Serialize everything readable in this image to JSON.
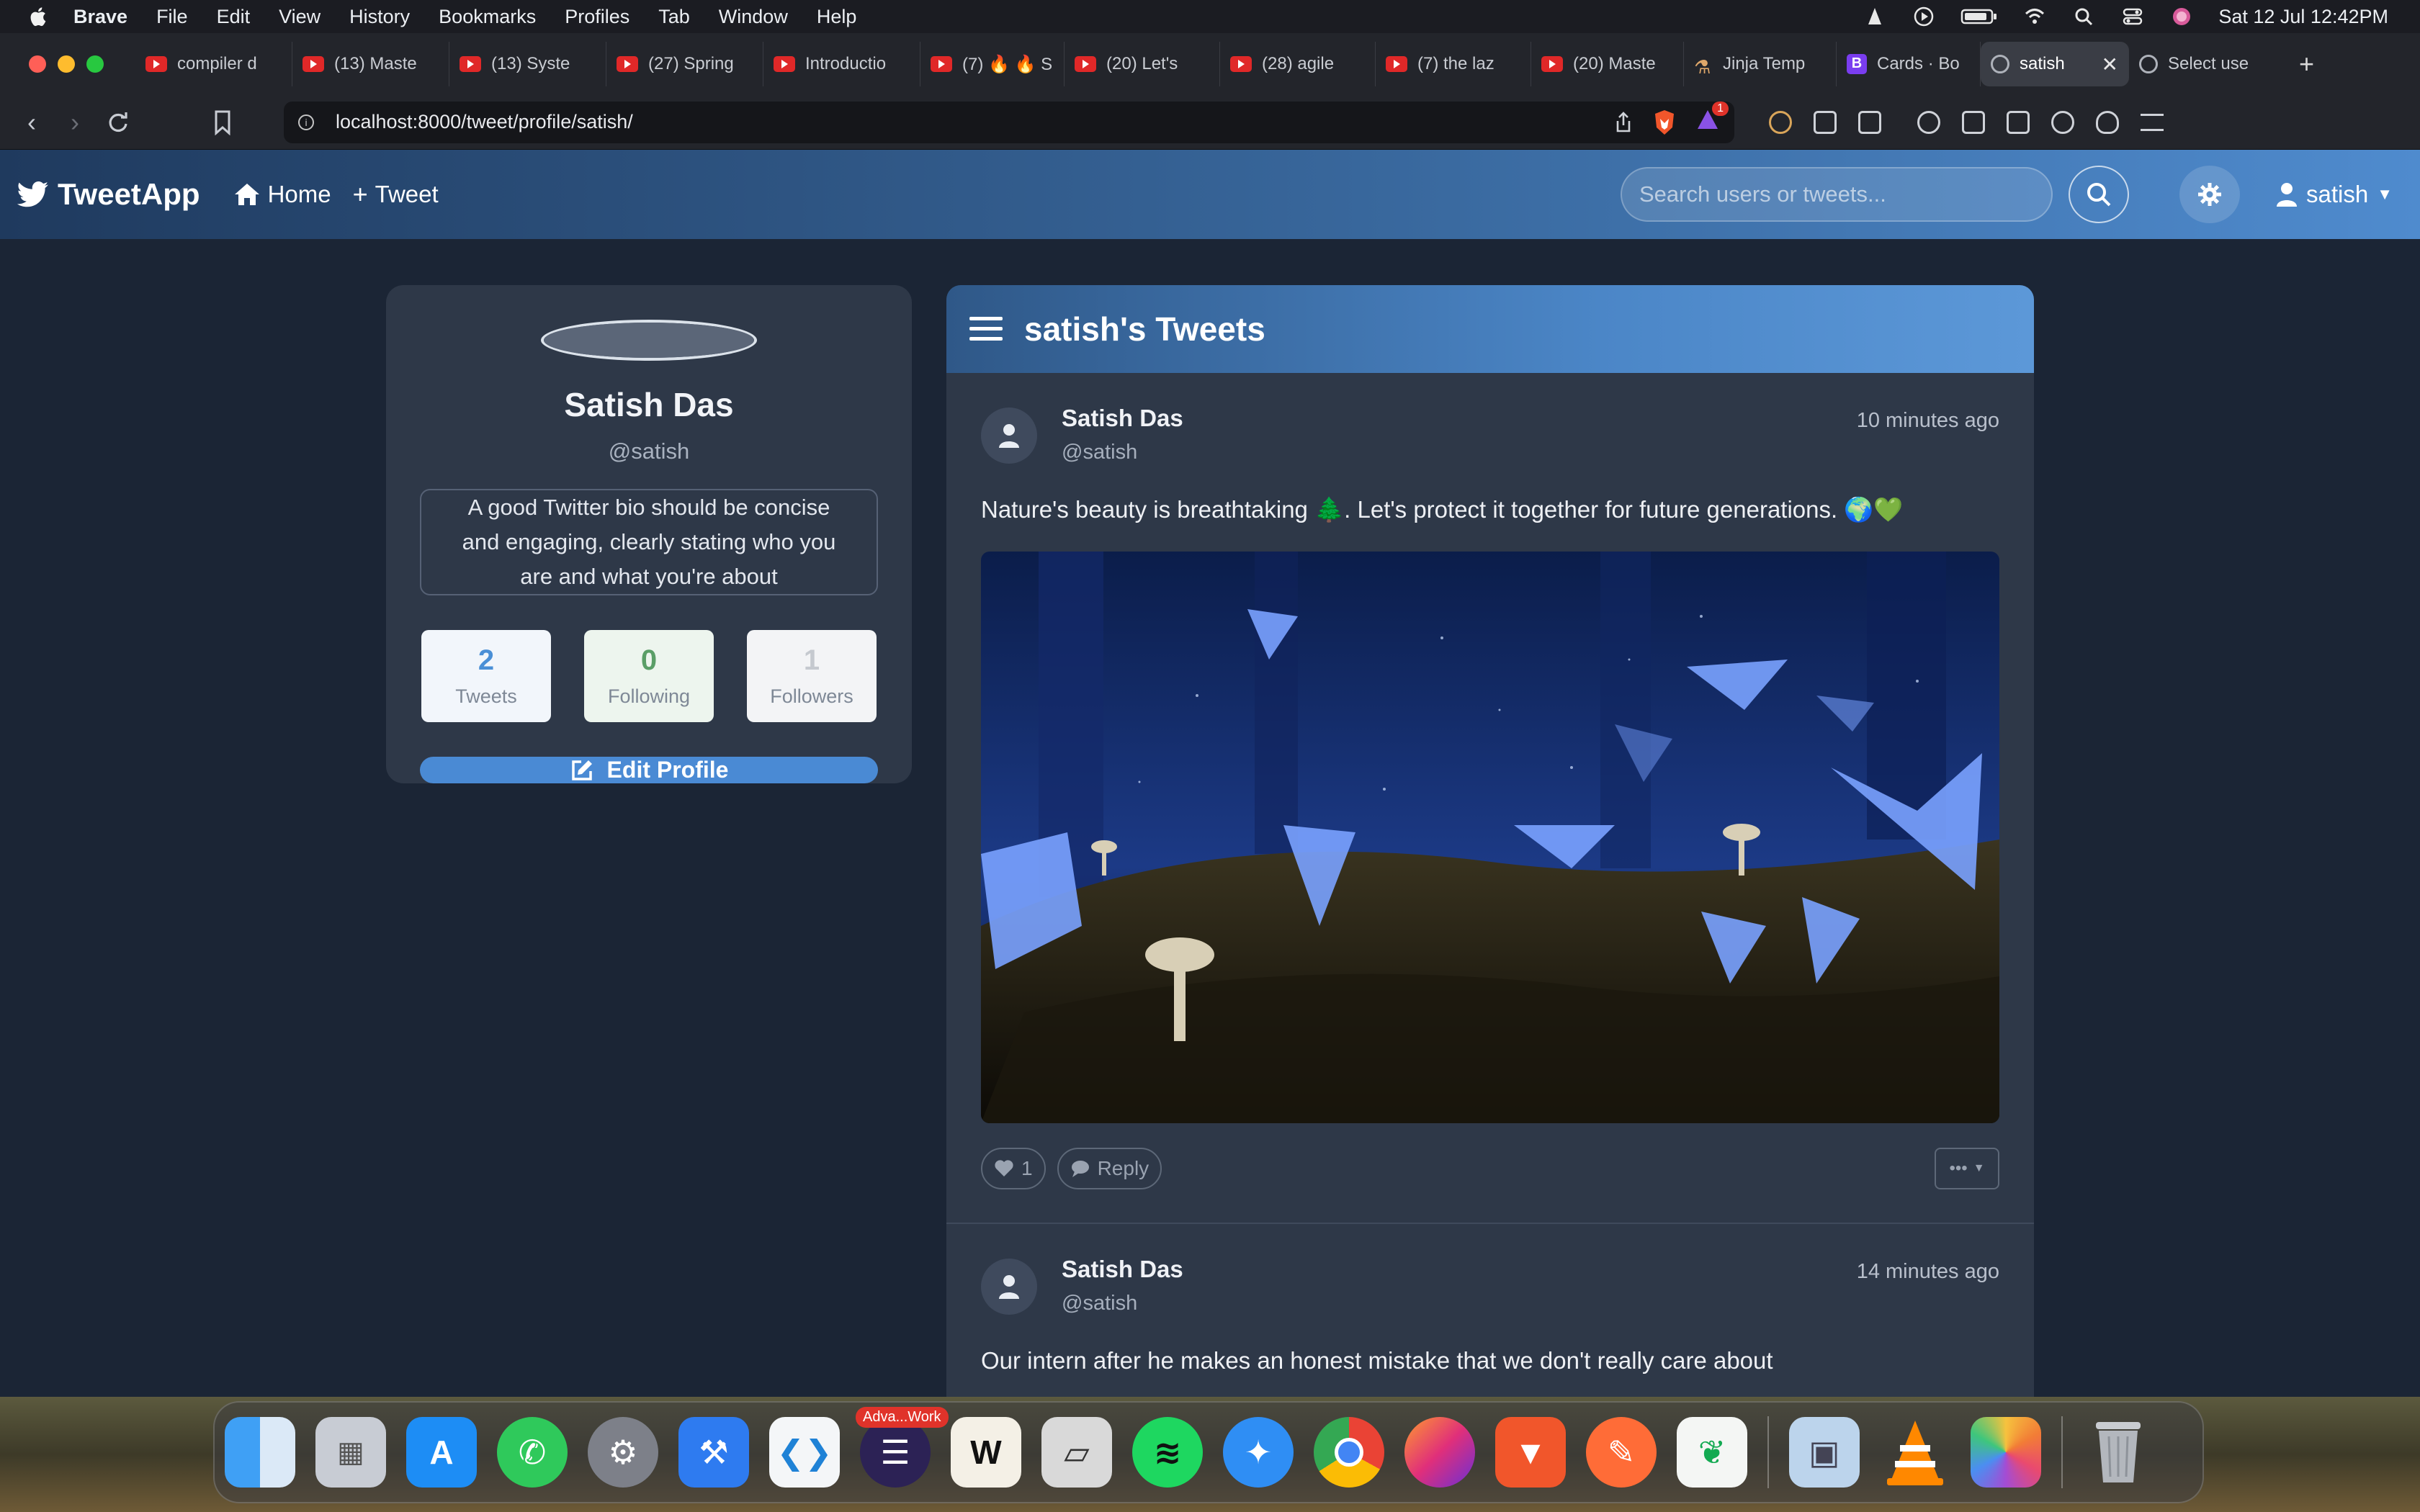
{
  "menubar": {
    "app_name": "Brave",
    "items": [
      "File",
      "Edit",
      "View",
      "History",
      "Bookmarks",
      "Profiles",
      "Tab",
      "Window",
      "Help"
    ],
    "datetime": "Sat 12 Jul  12:42PM"
  },
  "tabs": [
    {
      "label": "compiler d",
      "icon": "youtube-icon"
    },
    {
      "label": "(13) Maste",
      "icon": "youtube-icon"
    },
    {
      "label": "(13) Syste",
      "icon": "youtube-icon"
    },
    {
      "label": "(27) Spring",
      "icon": "youtube-icon"
    },
    {
      "label": "Introductio",
      "icon": "youtube-icon"
    },
    {
      "label": "(7) 🔥 🔥 S",
      "icon": "youtube-icon"
    },
    {
      "label": "(20) Let's",
      "icon": "youtube-icon"
    },
    {
      "label": "(28) agile",
      "icon": "youtube-icon"
    },
    {
      "label": "(7) the laz",
      "icon": "youtube-icon"
    },
    {
      "label": "(20) Maste",
      "icon": "youtube-icon"
    },
    {
      "label": "Jinja Temp",
      "icon": "flask-icon"
    },
    {
      "label": "Cards · Bo",
      "icon": "bootstrap-icon"
    },
    {
      "label": "satish",
      "icon": "globe-icon",
      "active": true
    },
    {
      "label": "Select use",
      "icon": "globe-icon"
    }
  ],
  "address_bar": {
    "url": "localhost:8000/tweet/profile/satish/",
    "shield_badge": "1"
  },
  "app": {
    "brand": "TweetApp",
    "nav_home": "Home",
    "nav_tweet": "Tweet",
    "search_placeholder": "Search users or tweets...",
    "username": "satish"
  },
  "profile": {
    "name": "Satish Das",
    "handle": "@satish",
    "bio": "A good Twitter bio should be concise and engaging, clearly stating who you are and what you're about",
    "stats": {
      "tweets": {
        "value": "2",
        "label": "Tweets"
      },
      "following": {
        "value": "0",
        "label": "Following"
      },
      "followers": {
        "value": "1",
        "label": "Followers"
      }
    },
    "edit_label": "Edit Profile"
  },
  "tweets_panel": {
    "title": "satish's Tweets",
    "tweets": [
      {
        "name": "Satish Das",
        "handle": "@satish",
        "time": "10 minutes ago",
        "text": "Nature's beauty is breathtaking 🌲. Let's protect it together for future generations. 🌍💚",
        "likes": "1",
        "reply_label": "Reply"
      },
      {
        "name": "Satish Das",
        "handle": "@satish",
        "time": "14 minutes ago",
        "text": "Our intern after he makes an honest mistake that we don't really care about"
      }
    ]
  },
  "dock": {
    "badge": "Adva...Work",
    "apps": [
      "finder-icon",
      "launchpad-icon",
      "app-store-icon",
      "whatsapp-icon",
      "system-settings-icon",
      "xcode-icon",
      "vscode-icon",
      "eclipse-icon",
      "wezterm-icon",
      "parallels-icon",
      "spotify-icon",
      "safari-icon",
      "chrome-icon",
      "firefox-icon",
      "brave-icon",
      "postman-icon",
      "mongodb-compass-icon",
      "preview-icon",
      "vlc-icon",
      "photos-icon",
      "trash-icon"
    ]
  }
}
